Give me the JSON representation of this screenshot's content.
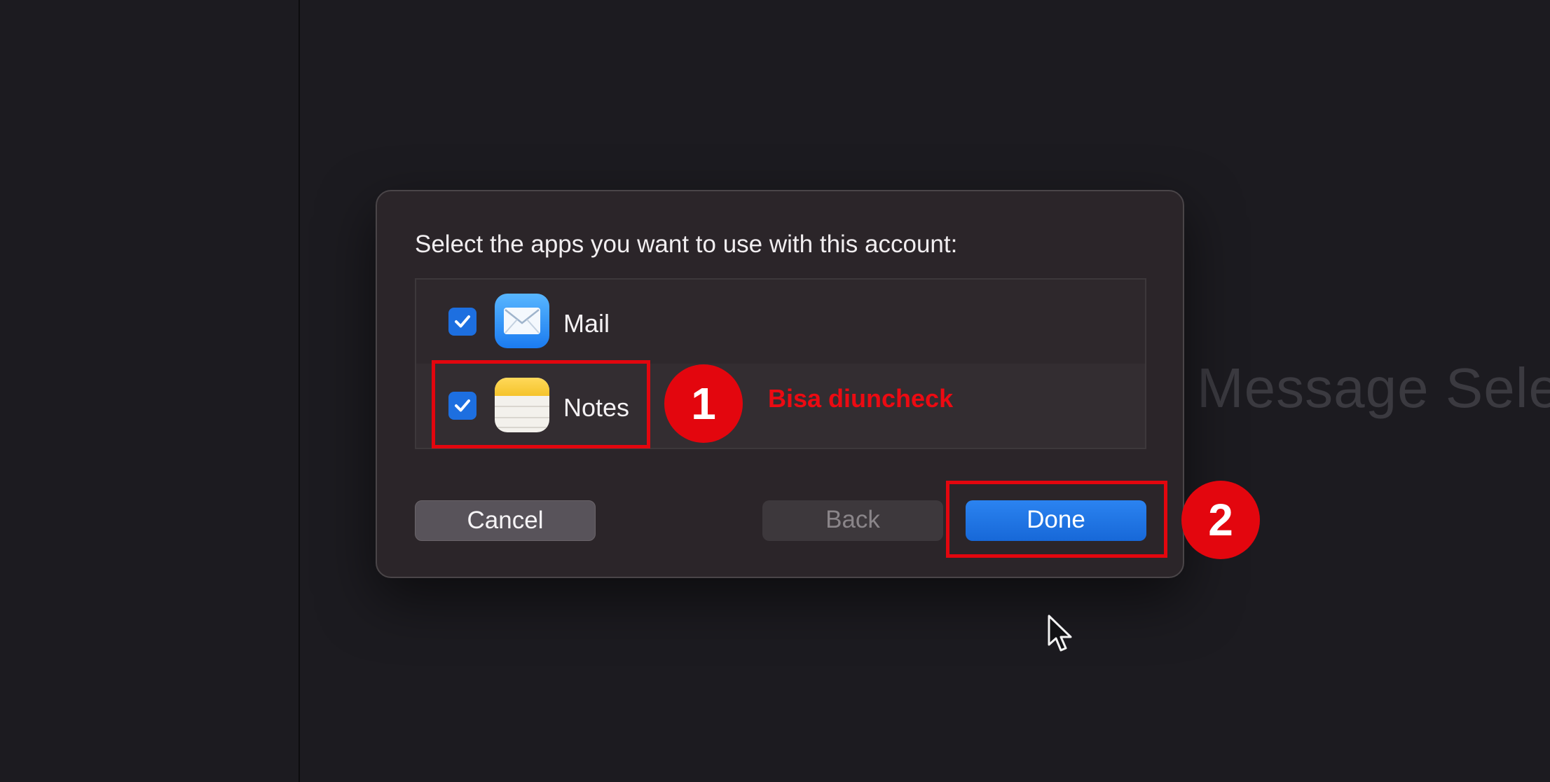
{
  "background": {
    "placeholder_text": "Message Selec"
  },
  "dialog": {
    "prompt": "Select the apps you want to use with this account:",
    "apps": [
      {
        "label": "Mail",
        "checked": true,
        "icon": "mail-icon"
      },
      {
        "label": "Notes",
        "checked": true,
        "icon": "notes-icon"
      }
    ],
    "buttons": {
      "cancel": "Cancel",
      "back": "Back",
      "done": "Done"
    }
  },
  "annotations": {
    "badge_1": "1",
    "badge_2": "2",
    "note": "Bisa diuncheck",
    "color": "#e3060e"
  },
  "colors": {
    "accent": "#1d6fe0",
    "dialog_bg": "#2b2529",
    "page_bg": "#1c1b20"
  }
}
